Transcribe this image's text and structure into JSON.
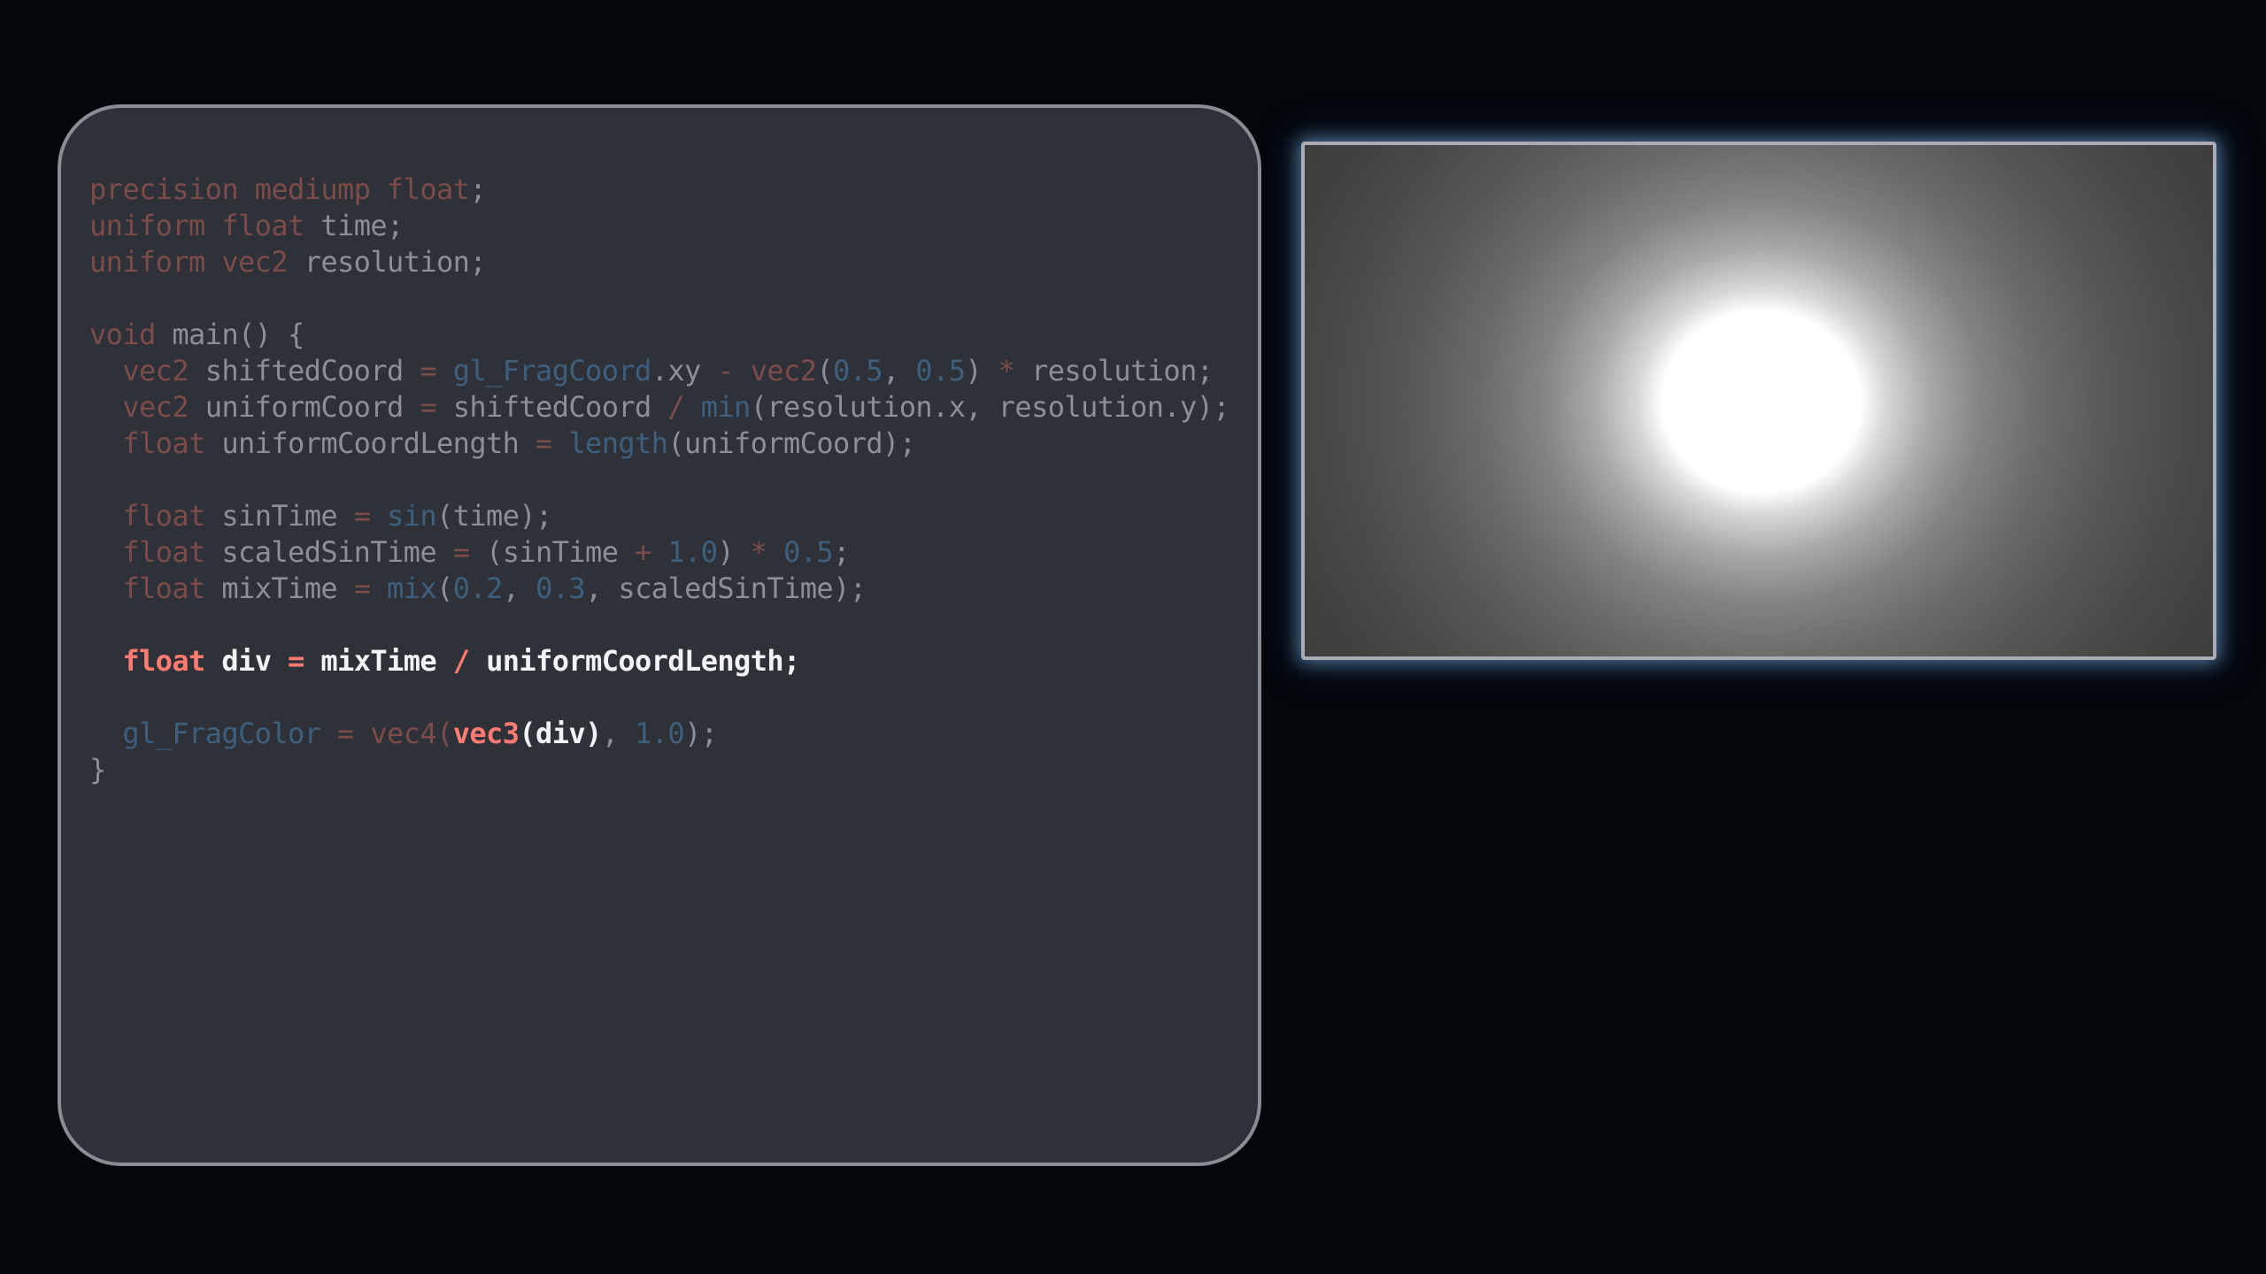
{
  "editor": {
    "lines": [
      {
        "dim": true,
        "tokens": [
          [
            "kw",
            "precision"
          ],
          [
            "pn",
            " "
          ],
          [
            "kw",
            "mediump"
          ],
          [
            "pn",
            " "
          ],
          [
            "kw",
            "float"
          ],
          [
            "pn",
            ";"
          ]
        ]
      },
      {
        "dim": true,
        "tokens": [
          [
            "kw",
            "uniform"
          ],
          [
            "pn",
            " "
          ],
          [
            "kw",
            "float"
          ],
          [
            "pn",
            " "
          ],
          [
            "id",
            "time"
          ],
          [
            "pn",
            ";"
          ]
        ]
      },
      {
        "dim": true,
        "tokens": [
          [
            "kw",
            "uniform"
          ],
          [
            "pn",
            " "
          ],
          [
            "kw",
            "vec2"
          ],
          [
            "pn",
            " "
          ],
          [
            "id",
            "resolution"
          ],
          [
            "pn",
            ";"
          ]
        ]
      },
      {
        "dim": true,
        "tokens": []
      },
      {
        "dim": true,
        "tokens": [
          [
            "kw",
            "void"
          ],
          [
            "pn",
            " "
          ],
          [
            "id",
            "main"
          ],
          [
            "pn",
            "() {"
          ]
        ]
      },
      {
        "dim": true,
        "tokens": [
          [
            "pn",
            "  "
          ],
          [
            "kw",
            "vec2"
          ],
          [
            "pn",
            " "
          ],
          [
            "id",
            "shiftedCoord"
          ],
          [
            "pn",
            " "
          ],
          [
            "op",
            "="
          ],
          [
            "pn",
            " "
          ],
          [
            "fn",
            "gl_FragCoord"
          ],
          [
            "id",
            ".xy"
          ],
          [
            "pn",
            " "
          ],
          [
            "op",
            "-"
          ],
          [
            "pn",
            " "
          ],
          [
            "kw",
            "vec2"
          ],
          [
            "pn",
            "("
          ],
          [
            "num",
            "0.5"
          ],
          [
            "pn",
            ", "
          ],
          [
            "num",
            "0.5"
          ],
          [
            "pn",
            ") "
          ],
          [
            "op",
            "*"
          ],
          [
            "pn",
            " "
          ],
          [
            "id",
            "resolution"
          ],
          [
            "pn",
            ";"
          ]
        ]
      },
      {
        "dim": true,
        "tokens": [
          [
            "pn",
            "  "
          ],
          [
            "kw",
            "vec2"
          ],
          [
            "pn",
            " "
          ],
          [
            "id",
            "uniformCoord"
          ],
          [
            "pn",
            " "
          ],
          [
            "op",
            "="
          ],
          [
            "pn",
            " "
          ],
          [
            "id",
            "shiftedCoord"
          ],
          [
            "pn",
            " "
          ],
          [
            "op",
            "/"
          ],
          [
            "pn",
            " "
          ],
          [
            "fn",
            "min"
          ],
          [
            "pn",
            "("
          ],
          [
            "id",
            "resolution.x"
          ],
          [
            "pn",
            ", "
          ],
          [
            "id",
            "resolution.y"
          ],
          [
            "pn",
            ");"
          ]
        ]
      },
      {
        "dim": true,
        "tokens": [
          [
            "pn",
            "  "
          ],
          [
            "kw",
            "float"
          ],
          [
            "pn",
            " "
          ],
          [
            "id",
            "uniformCoordLength"
          ],
          [
            "pn",
            " "
          ],
          [
            "op",
            "="
          ],
          [
            "pn",
            " "
          ],
          [
            "fn",
            "length"
          ],
          [
            "pn",
            "("
          ],
          [
            "id",
            "uniformCoord"
          ],
          [
            "pn",
            ");"
          ]
        ]
      },
      {
        "dim": true,
        "tokens": []
      },
      {
        "dim": true,
        "tokens": [
          [
            "pn",
            "  "
          ],
          [
            "kw",
            "float"
          ],
          [
            "pn",
            " "
          ],
          [
            "id",
            "sinTime"
          ],
          [
            "pn",
            " "
          ],
          [
            "op",
            "="
          ],
          [
            "pn",
            " "
          ],
          [
            "fn",
            "sin"
          ],
          [
            "pn",
            "("
          ],
          [
            "id",
            "time"
          ],
          [
            "pn",
            ");"
          ]
        ]
      },
      {
        "dim": true,
        "tokens": [
          [
            "pn",
            "  "
          ],
          [
            "kw",
            "float"
          ],
          [
            "pn",
            " "
          ],
          [
            "id",
            "scaledSinTime"
          ],
          [
            "pn",
            " "
          ],
          [
            "op",
            "="
          ],
          [
            "pn",
            " ("
          ],
          [
            "id",
            "sinTime"
          ],
          [
            "pn",
            " "
          ],
          [
            "op",
            "+"
          ],
          [
            "pn",
            " "
          ],
          [
            "num",
            "1.0"
          ],
          [
            "pn",
            ") "
          ],
          [
            "op",
            "*"
          ],
          [
            "pn",
            " "
          ],
          [
            "num",
            "0.5"
          ],
          [
            "pn",
            ";"
          ]
        ]
      },
      {
        "dim": true,
        "tokens": [
          [
            "pn",
            "  "
          ],
          [
            "kw",
            "float"
          ],
          [
            "pn",
            " "
          ],
          [
            "id",
            "mixTime"
          ],
          [
            "pn",
            " "
          ],
          [
            "op",
            "="
          ],
          [
            "pn",
            " "
          ],
          [
            "fn",
            "mix"
          ],
          [
            "pn",
            "("
          ],
          [
            "num",
            "0.2"
          ],
          [
            "pn",
            ", "
          ],
          [
            "num",
            "0.3"
          ],
          [
            "pn",
            ", "
          ],
          [
            "id",
            "scaledSinTime"
          ],
          [
            "pn",
            ");"
          ]
        ]
      },
      {
        "dim": true,
        "tokens": []
      },
      {
        "dim": false,
        "tokens": [
          [
            "pn",
            "  "
          ],
          [
            "kw",
            "float"
          ],
          [
            "pn",
            " "
          ],
          [
            "id",
            "div"
          ],
          [
            "pn",
            " "
          ],
          [
            "op",
            "="
          ],
          [
            "pn",
            " "
          ],
          [
            "id",
            "mixTime"
          ],
          [
            "pn",
            " "
          ],
          [
            "op",
            "/"
          ],
          [
            "pn",
            " "
          ],
          [
            "id",
            "uniformCoordLength"
          ],
          [
            "pn",
            ";"
          ]
        ]
      },
      {
        "dim": true,
        "tokens": []
      },
      {
        "dim": true,
        "tokens": [
          [
            "pn",
            "  "
          ],
          [
            "fn",
            "gl_FragColor"
          ],
          [
            "pn",
            " "
          ],
          [
            "op",
            "="
          ],
          [
            "pn",
            " "
          ],
          [
            "kw",
            "vec4"
          ],
          [
            "kw",
            "("
          ],
          [
            "hlfn",
            "vec3"
          ],
          [
            "hlpn",
            "("
          ],
          [
            "hlid",
            "div"
          ],
          [
            "hlpn",
            ")"
          ],
          [
            "pn",
            ", "
          ],
          [
            "num",
            "1.0"
          ],
          [
            "pn",
            ");"
          ]
        ]
      },
      {
        "dim": true,
        "tokens": [
          [
            "pn",
            "}"
          ]
        ]
      }
    ]
  },
  "preview": {
    "colors": {
      "background": "#3a3a3a",
      "glow": "#ffffff",
      "border": "#a9acb2",
      "halo": "#78aadc"
    }
  },
  "colors": {
    "page_background": "#03060b",
    "editor_background": "#2e3137",
    "editor_border": "#8a8d93",
    "keyword_highlight": "#ff7b72",
    "keyword_dim": "#7c4c4a",
    "function_dim": "#3f5f7e",
    "text_dim": "#8b8f96",
    "text_highlight": "#f2f3f5"
  }
}
